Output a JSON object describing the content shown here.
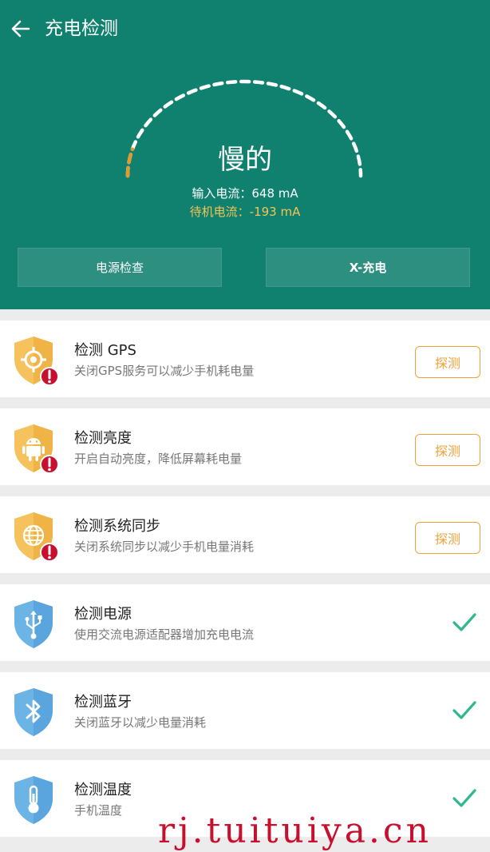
{
  "app": {
    "title": "充电检测"
  },
  "status": {
    "speed_label": "慢的",
    "input_current": "输入电流：648 mA",
    "standby_current": "待机电流：-193 mA",
    "gauge_progress": 0.1
  },
  "buttons": {
    "power_check": "电源检查",
    "x_charge": "X-充电"
  },
  "items": [
    {
      "title": "检测 GPS",
      "desc": "关闭GPS服务可以减少手机耗电量",
      "state": "warning",
      "action": "探测",
      "icon": "gps-icon"
    },
    {
      "title": "检测亮度",
      "desc": "开启自动亮度，降低屏幕耗电量",
      "state": "warning",
      "action": "探测",
      "icon": "android-icon"
    },
    {
      "title": "检测系统同步",
      "desc": "关闭系统同步以减少手机电量消耗",
      "state": "warning",
      "action": "探测",
      "icon": "globe-icon"
    },
    {
      "title": "检测电源",
      "desc": "使用交流电源适配器增加充电电流",
      "state": "ok",
      "icon": "usb-icon"
    },
    {
      "title": "检测蓝牙",
      "desc": "关闭蓝牙以减少电量消耗",
      "state": "ok",
      "icon": "bluetooth-icon"
    },
    {
      "title": "检测温度",
      "desc": "手机温度",
      "state": "ok",
      "icon": "thermometer-icon"
    }
  ],
  "watermark": "rj.tuituiya.cn",
  "colors": {
    "header_bg": "#10806f",
    "warning_shield": "#f5c25e",
    "ok_shield": "#5aa5de",
    "alert_badge": "#c8102e",
    "check": "#2fb890",
    "probe_border": "#f0a23a"
  }
}
